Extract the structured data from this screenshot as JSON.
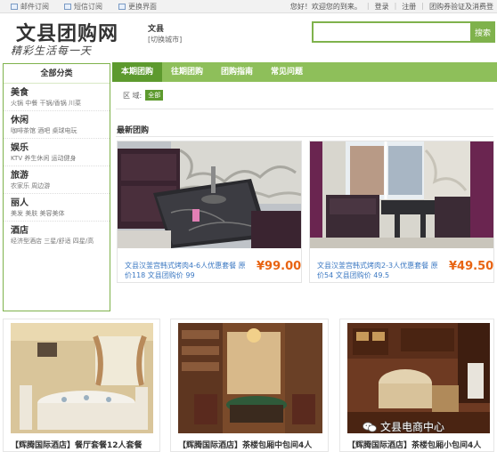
{
  "topbar": {
    "mail_subscribe": "邮件订阅",
    "sms_subscribe": "短信订阅",
    "change_theme": "更换界面",
    "welcome": "您好！欢迎您的到来。",
    "login": "登录",
    "register": "注册",
    "coupon_verify": "团购券验证及消费登"
  },
  "header": {
    "logo": "文县团购网",
    "slogan": "精彩生活每一天",
    "city": "文县",
    "city_switch": "[切换城市]",
    "search_placeholder": "",
    "search_button": "搜索"
  },
  "sidebar": {
    "title": "全部分类",
    "categories": [
      {
        "name": "美食",
        "subs": "火锅  中餐  干锅/香锅  川菜"
      },
      {
        "name": "休闲",
        "subs": "咖啡茶馆  酒吧  桌球电玩"
      },
      {
        "name": "娱乐",
        "subs": "KTV  养生休闲  运动健身"
      },
      {
        "name": "旅游",
        "subs": "农家乐  周边游"
      },
      {
        "name": "丽人",
        "subs": "美发  美肤  美容美体"
      },
      {
        "name": "酒店",
        "subs": "经济型酒店  三星/舒适  四星/高"
      }
    ]
  },
  "nav": {
    "tabs": [
      "本期团购",
      "往期团购",
      "团购指南",
      "常见问题"
    ]
  },
  "filter": {
    "label": "区 域:",
    "all": "全部"
  },
  "section": {
    "latest": "最新团购"
  },
  "deals": [
    {
      "title": "文县汉釜宫韩式烤肉4-6人优惠套餐 原",
      "sub": "价118 文县团购价 99",
      "price": "¥99.00"
    },
    {
      "title": "文县汉釜宫韩式烤肉2-3人优惠套餐 原",
      "sub": "价54 文县团购价 49.5",
      "price": "¥49.50"
    }
  ],
  "bottom_deals": [
    {
      "title": "【辉腾国际酒店】餐厅套餐12人套餐"
    },
    {
      "title": "【辉腾国际酒店】茶楼包厢中包间4人"
    },
    {
      "title": "【辉腾国际酒店】茶楼包厢小包间4人"
    }
  ],
  "watermark": "文县电商中心",
  "colors": {
    "brand_green": "#7fb24c",
    "nav_active": "#5d9a2e",
    "price": "#e86413",
    "link": "#3b78c2"
  }
}
